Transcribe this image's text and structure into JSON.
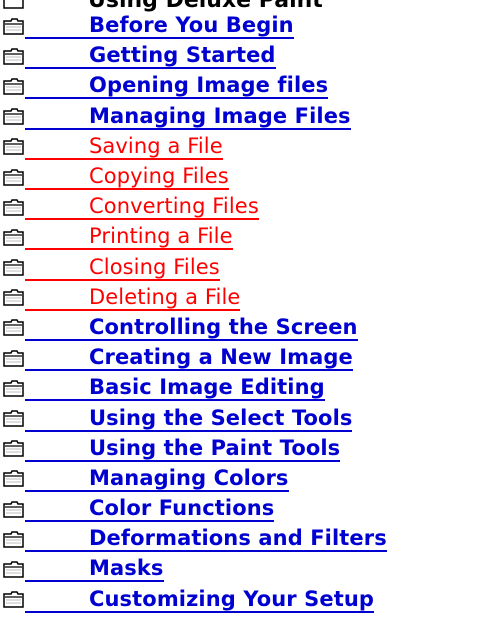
{
  "header": {
    "label": "Using Deluxe Paint"
  },
  "toc": {
    "items": [
      {
        "label": "Before You Begin",
        "level": 1
      },
      {
        "label": "Getting Started",
        "level": 1
      },
      {
        "label": "Opening Image files",
        "level": 1
      },
      {
        "label": "Managing Image Files",
        "level": 1
      },
      {
        "label": "Saving a File",
        "level": 2
      },
      {
        "label": "Copying Files",
        "level": 2
      },
      {
        "label": "Converting Files",
        "level": 2
      },
      {
        "label": "Printing a File",
        "level": 2
      },
      {
        "label": "Closing Files",
        "level": 2
      },
      {
        "label": "Deleting a File",
        "level": 2
      },
      {
        "label": "Controlling the Screen",
        "level": 1
      },
      {
        "label": "Creating a New Image",
        "level": 1
      },
      {
        "label": "Basic Image Editing",
        "level": 1
      },
      {
        "label": "Using the Select Tools",
        "level": 1
      },
      {
        "label": "Using the Paint Tools",
        "level": 1
      },
      {
        "label": "Managing Colors",
        "level": 1
      },
      {
        "label": "Color Functions",
        "level": 1
      },
      {
        "label": "Deformations and Filters",
        "level": 1
      },
      {
        "label": "Masks",
        "level": 1
      },
      {
        "label": "Customizing Your Setup",
        "level": 1
      }
    ]
  },
  "icons": {
    "folder": "closed-folder-icon"
  },
  "colors": {
    "topic_link": "#0000d0",
    "subtopic_link": "#ff0000",
    "background": "#ffffff"
  }
}
